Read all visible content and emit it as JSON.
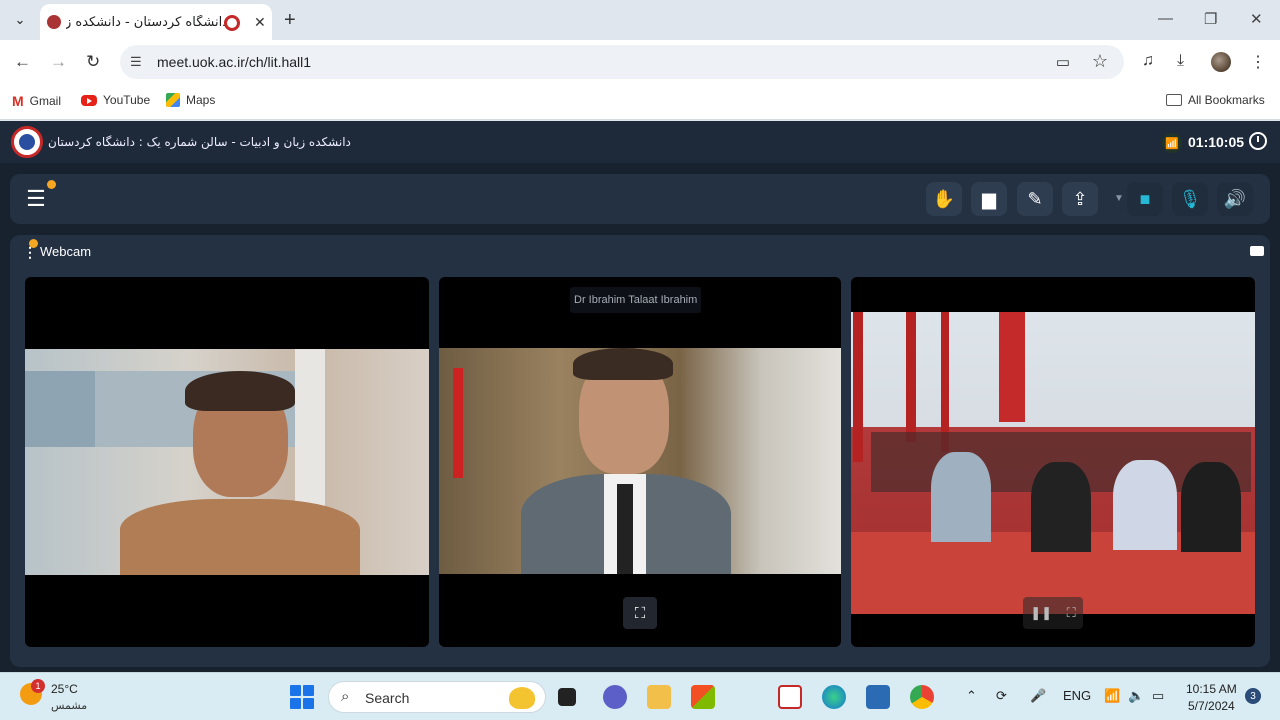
{
  "browser": {
    "tab_title": "دانشگاه کردستان - دانشکده ز",
    "url": "meet.uok.ac.ir/ch/lit.hall1",
    "bookmarks": [
      {
        "label": "Gmail",
        "icon": "gmail-icon"
      },
      {
        "label": "YouTube",
        "icon": "youtube-icon"
      },
      {
        "label": "Maps",
        "icon": "maps-icon"
      }
    ],
    "all_bookmarks": "All Bookmarks"
  },
  "app": {
    "room_title": "دانشکده زبان و ادبیات - سالن شماره یک : دانشگاه کردستان",
    "timer": "01:10:05",
    "panel_title": "Webcam",
    "participants": [
      {
        "name": ""
      },
      {
        "name": "Dr Ibrahim Talaat Ibrahim"
      },
      {
        "name": ""
      }
    ],
    "colors": {
      "accent": "#27b8d6",
      "header": "#1e2a3a",
      "panel": "#243142",
      "notify": "#f5a623"
    }
  },
  "taskbar": {
    "weather_temp": "25°C",
    "weather_cond": "مشمس",
    "weather_badge": "1",
    "search_label": "Search",
    "lang": "ENG",
    "time": "10:15 AM",
    "date": "5/7/2024",
    "notifications": "3"
  }
}
